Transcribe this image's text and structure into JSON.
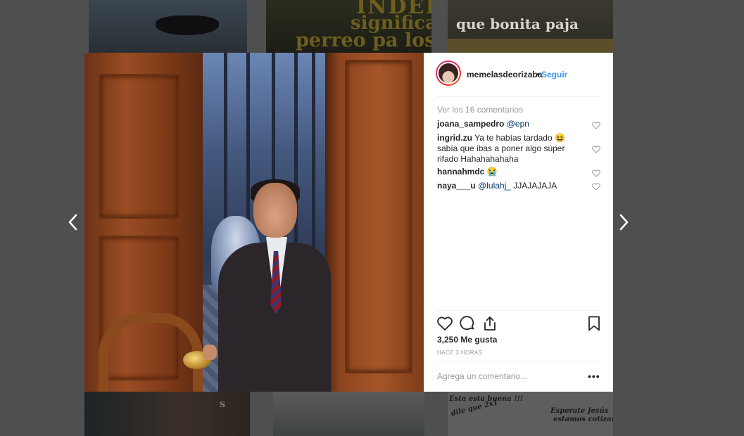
{
  "background_tiles": {
    "tile1": {},
    "tile2": {
      "line1": "INDELIS",
      "line2": "significa",
      "line3": "perreo pa los ne"
    },
    "tile3": {
      "caption": "que bonita paja"
    },
    "tile4": {
      "caption": "S"
    },
    "tile5": {},
    "tile6": {
      "line1": "Esta esta buena !!!",
      "line2": "dile que 2x1",
      "line3": "Esperate Jesús",
      "line4": "estamos cotizand"
    }
  },
  "navigation": {
    "prev_icon": "chevron-left-icon",
    "next_icon": "chevron-right-icon"
  },
  "post": {
    "username": "memelasdeorizaba",
    "separator": "•",
    "follow_label": "Seguir",
    "view_comments": "Ver los 16 comentarios",
    "comments": [
      {
        "user": "joana_sampedro",
        "mention": "@epn",
        "text": ""
      },
      {
        "user": "ingrid.zu",
        "mention": "",
        "text": "Ya te habías tardado 😆 sabía que ibas a poner algo súper rifado Hahahahahaha"
      },
      {
        "user": "hannahmdc",
        "mention": "",
        "text": "😭"
      },
      {
        "user": "naya___u",
        "mention": "@lulahj_",
        "text": "JJAJAJAJA"
      }
    ],
    "likes": "3,250 Me gusta",
    "timestamp": "HACE 3 HORAS",
    "add_comment_placeholder": "Agrega un comentario...",
    "more_label": "•••"
  },
  "colors": {
    "overlay": "#4f4f4f",
    "link_blue": "#3897f0",
    "text": "#262626",
    "muted": "#999999"
  }
}
